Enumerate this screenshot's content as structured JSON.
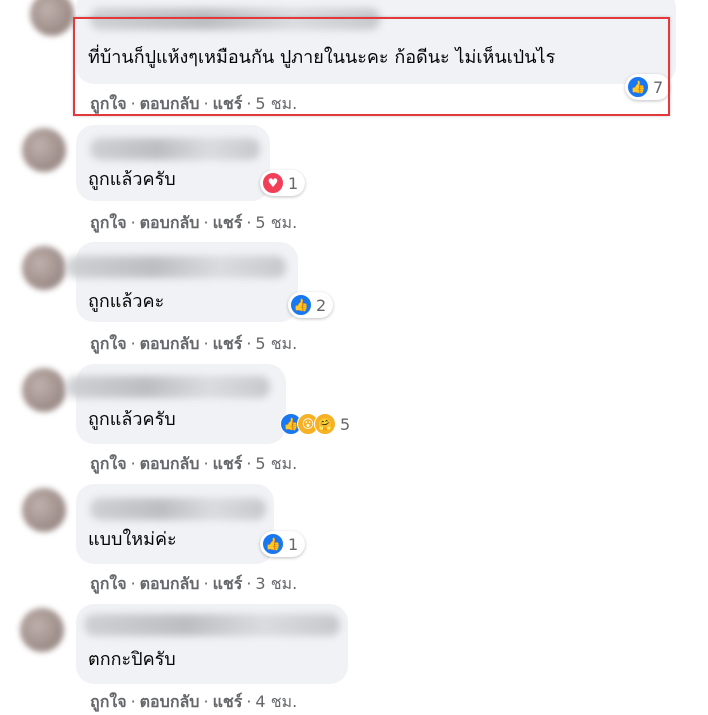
{
  "comments": [
    {
      "text": "ที่บ้านก็ปูแห้งๆเหมือนกัน ปูภายในนะคะ ก้อดีนะ ไม่เห็นเป่นไร",
      "reaction_count": "7",
      "reaction_icons": [
        "like-icon"
      ],
      "time": "5 ชม."
    },
    {
      "text": "ถูกแล้วครับ",
      "reaction_count": "1",
      "reaction_icons": [
        "love-icon"
      ],
      "time": "5 ชม."
    },
    {
      "text": "ถูกแล้วคะ",
      "reaction_count": "2",
      "reaction_icons": [
        "like-icon"
      ],
      "time": "5 ชม."
    },
    {
      "text": "ถูกแล้วครับ",
      "reaction_count": "5",
      "reaction_icons": [
        "like-icon",
        "wow-icon",
        "care-icon"
      ],
      "time": "5 ชม."
    },
    {
      "text": "แบบใหม่ค่ะ",
      "reaction_count": "1",
      "reaction_icons": [
        "like-icon"
      ],
      "time": "3 ชม."
    },
    {
      "text": "ตกกะปิครับ",
      "reaction_count": "",
      "reaction_icons": [],
      "time": "4 ชม."
    }
  ],
  "actions": {
    "like": "ถูกใจ",
    "reply": "ตอบกลับ",
    "share": "แชร์",
    "dot": "·"
  },
  "colors": {
    "like": "#1877f2",
    "love": "#f33e58",
    "wow": "#f7b125",
    "highlight_border": "#e4393c",
    "bubble_bg": "#f0f2f5",
    "meta_text": "#65676b"
  }
}
